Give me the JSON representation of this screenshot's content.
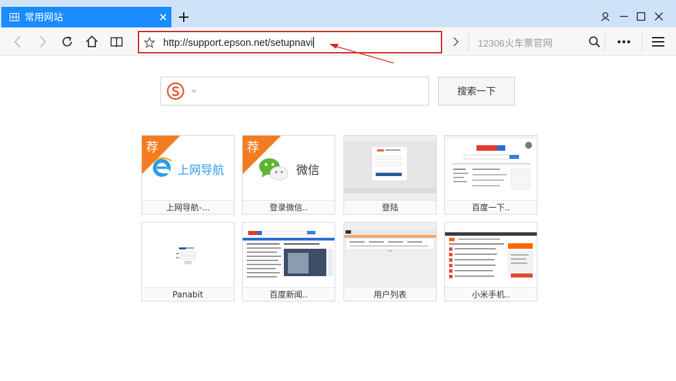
{
  "tab": {
    "title": "常用网站",
    "close_icon": "close-icon",
    "grid_icon": "grid-icon"
  },
  "address_bar": {
    "url": "http://support.epson.net/setupnavi",
    "highlight_color": "#d42b2b"
  },
  "search_engine_box": {
    "placeholder": "12306火车票官网"
  },
  "search": {
    "button_label": "搜索一下"
  },
  "tiles": [
    {
      "label": "上网导航-...",
      "badge": "荐",
      "brand": "上网导航"
    },
    {
      "label": "登录微信..",
      "badge": "荐",
      "brand": "微信"
    },
    {
      "label": "登陆"
    },
    {
      "label": "百度一下.."
    },
    {
      "label": "Panabit"
    },
    {
      "label": "百度新闻.."
    },
    {
      "label": "用户列表"
    },
    {
      "label": "小米手机.."
    }
  ],
  "colors": {
    "accent": "#1a8cff",
    "badge": "#f47c20",
    "annotation": "#d42b2b"
  }
}
